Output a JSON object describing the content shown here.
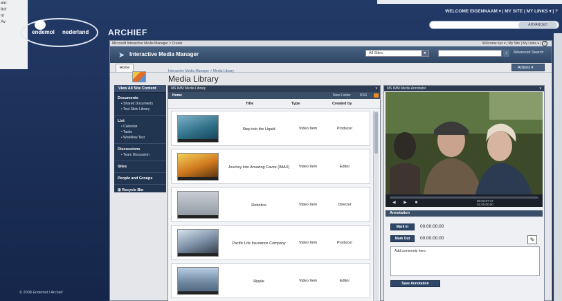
{
  "background": {
    "left_strip_lines": [
      "ele:",
      "",
      "bor",
      "nt",
      "Av"
    ],
    "topnav": "WELCOME EIGENNAAM ▾  |  MY SITE  |  MY LINKS ▾  |  ?",
    "search_advanced": "ADVANCED",
    "logo_left": "endemol",
    "logo_right": "nederland",
    "title": "ARCHIEF",
    "copyright": "© 2008 Endemol / Archief"
  },
  "app": {
    "window_title": "Microsoft Interactive Media Manager > Create",
    "welcome": "Welcome xyz  ▾  |  My Site  |  My Links  ▾  |",
    "help": "?",
    "name": "Interactive Media Manager",
    "scope_select": "All Sites",
    "advanced_search": "Advanced Search",
    "home_tab": "Home",
    "actions": "Actions",
    "breadcrumb": "Interactive Media Manager > Media Library",
    "page_title": "Media Library"
  },
  "nav": {
    "view_all": "View All Site Content",
    "groups": [
      {
        "title": "Documents",
        "items": [
          "• Shared Documents",
          "• Test Slide Library"
        ]
      },
      {
        "title": "List",
        "items": [
          "• Calendar",
          "• Tasks",
          "• Workflow Test"
        ]
      },
      {
        "title": "Discussions",
        "items": [
          "• Team Discussion"
        ]
      },
      {
        "title": "Sites",
        "items": []
      },
      {
        "title": "People and Groups",
        "items": []
      },
      {
        "title": "⊞ Recycle Bin",
        "items": []
      }
    ]
  },
  "library": {
    "webpart_title": "MS IMM Media Library",
    "home": "Home",
    "new_folder": "New Folder",
    "rss": "RSS",
    "columns": {
      "title": "Title",
      "type": "Type",
      "created_by": "Created by"
    },
    "rows": [
      {
        "title": "Step into the Liquid",
        "type": "Video Item",
        "created_by": "Producer"
      },
      {
        "title": "Journey Into Amazing Caves (IMAX)",
        "type": "Video Item",
        "created_by": "Editor"
      },
      {
        "title": "Robotics",
        "type": "Video Item",
        "created_by": "Director"
      },
      {
        "title": "Pacific Life Insurance Company",
        "type": "Video Item",
        "created_by": "Producer"
      },
      {
        "title": "Ripple",
        "type": "Video Item",
        "created_by": "Editor"
      }
    ]
  },
  "annotator": {
    "webpart_title": "MS IMM Media Annotator",
    "time_current": "00:02:07:17",
    "time_total": "01:00:00:00",
    "section": "Annotation",
    "mark_in": "Mark In",
    "mark_in_time": "00:00:00:00",
    "mark_out": "Mark Out",
    "mark_out_time": "00:00:00:00",
    "comments_placeholder": "Add comments here.",
    "save": "Save Annotation"
  }
}
